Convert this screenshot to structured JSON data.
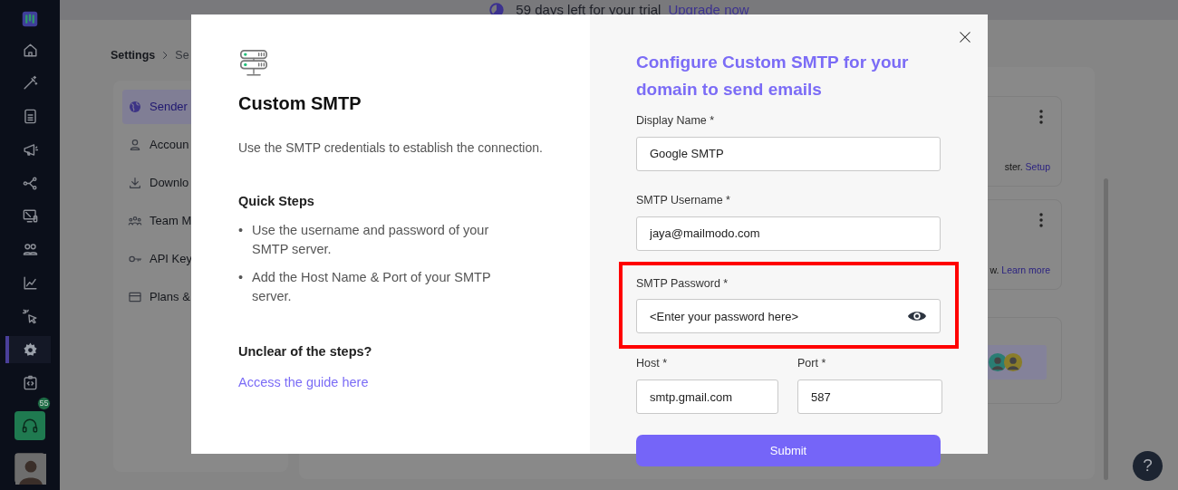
{
  "trial_banner": {
    "text": "59 days left for your trial",
    "link": "Upgrade now"
  },
  "sidebar": {
    "items": [
      {
        "selected": false
      },
      {
        "selected": false
      },
      {
        "selected": false
      },
      {
        "selected": false
      },
      {
        "selected": false
      },
      {
        "selected": false
      },
      {
        "selected": false
      },
      {
        "selected": false
      },
      {
        "selected": false
      },
      {
        "selected": true
      },
      {
        "selected": false
      }
    ],
    "support_badge": "55"
  },
  "breadcrumb": [
    "Settings",
    "Se"
  ],
  "settings_menu": [
    {
      "label": "Sender",
      "selected": true
    },
    {
      "label": "Accoun",
      "selected": false
    },
    {
      "label": "Downlo",
      "selected": false
    },
    {
      "label": "Team M",
      "selected": false
    },
    {
      "label": "API Key",
      "selected": false
    },
    {
      "label": "Plans &",
      "selected": false
    }
  ],
  "help_button": "?",
  "cards": [
    {
      "kind": "menu",
      "text": "ster.",
      "link": "Setup"
    },
    {
      "kind": "menu",
      "text": "w.",
      "link": "Learn more"
    },
    {
      "kind": "team"
    }
  ],
  "modal": {
    "title": "Custom SMTP",
    "description": "Use the SMTP credentials to establish the connection.",
    "steps_title": "Quick Steps",
    "steps": [
      "Use the username and password of your SMTP server.",
      "Add the Host Name & Port of your SMTP server."
    ],
    "help_title": "Unclear of the steps?",
    "help_link": "Access the guide here",
    "form_title": "Configure Custom SMTP for your domain to send emails",
    "fields": [
      {
        "label": "Display Name *",
        "value": "Google SMTP",
        "highlighted": false
      },
      {
        "label": "SMTP Username *",
        "value": "jaya@mailmodo.com",
        "highlighted": false
      },
      {
        "label": "SMTP Password *",
        "value": "<Enter your password here>",
        "kind": "password",
        "highlighted": true
      }
    ],
    "bullet": "•",
    "host": {
      "label": "Host *",
      "value": "smtp.gmail.com"
    },
    "port": {
      "label": "Port *",
      "value": "587"
    },
    "submit": "Submit"
  }
}
